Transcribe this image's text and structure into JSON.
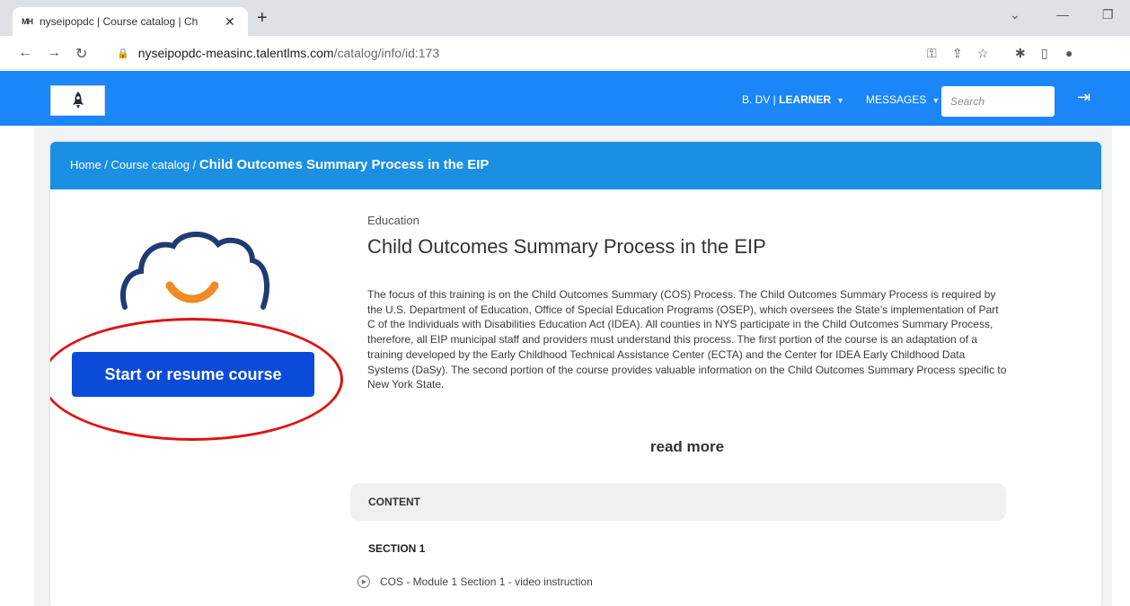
{
  "browser": {
    "tab_title": "nyseipopdc | Course catalog | Ch",
    "tab_favicon": "MH",
    "url_host": "nyseipopdc-measinc.talentlms.com",
    "url_path": "/catalog/info/id:173"
  },
  "header": {
    "user_name": "B. DV",
    "user_role": "LEARNER",
    "messages_label": "MESSAGES",
    "search_placeholder": "Search"
  },
  "breadcrumb": {
    "home": "Home",
    "catalog": "Course catalog",
    "current": "Child Outcomes Summary Process in the EIP"
  },
  "course": {
    "category": "Education",
    "title": "Child Outcomes Summary Process in the EIP",
    "description": "The focus of this training is on the Child Outcomes Summary (COS) Process. The Child Outcomes Summary Process is required by the U.S. Department of Education, Office of Special Education Programs (OSEP), which oversees the State’s implementation of Part C of the Individuals with Disabilities Education Act (IDEA). All counties in NYS participate in the Child Outcomes Summary Process, therefore, all EIP municipal staff and providers must understand this process. The first portion of the course is an adaptation of a training developed by the Early Childhood Technical Assistance Center (ECTA) and the Center for IDEA Early Childhood Data Systems (DaSy). The second portion of the course provides valuable information on the Child Outcomes Summary Process specific to New York State.",
    "read_more": "read more",
    "start_button": "Start or resume course"
  },
  "content": {
    "heading": "CONTENT",
    "sections": [
      {
        "title": "SECTION 1",
        "units": [
          "COS - Module 1 Section 1 - video instruction"
        ]
      }
    ]
  },
  "colors": {
    "header_blue": "#1b86f7",
    "breadcrumb_blue": "#1a8fe3",
    "button_blue": "#0a4bd8",
    "highlight_red": "#e01212"
  },
  "icons": [
    "rocket-icon",
    "logout-icon",
    "lock-icon",
    "play-icon",
    "cloud-smile-icon"
  ]
}
